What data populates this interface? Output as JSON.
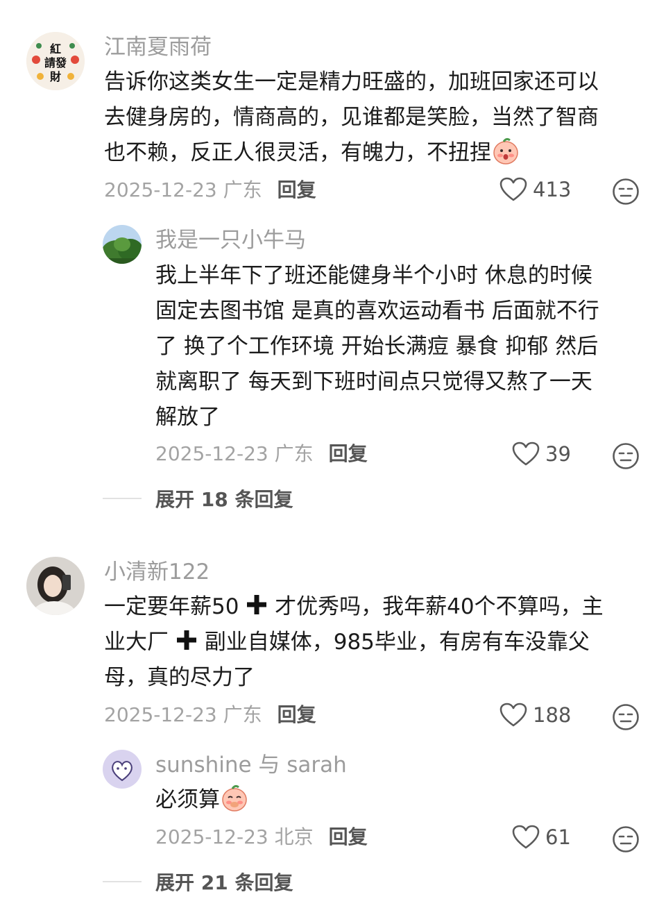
{
  "comments": [
    {
      "username": "江南夏雨荷",
      "avatar_text": "紅請發財",
      "lines": [
        "告诉你这类女生一定是精力旺盛的，加班回家还可以",
        "去健身房的，情商高的，见谁都是笑脸，当然了智商",
        "也不赖，反正人很灵活，有魄力，不扭捏"
      ],
      "emoji": "blushing-peach-emoji",
      "meta": "2025-12-23 广东",
      "reply_label": "回复",
      "likes": "413",
      "reply": {
        "username": "我是一只小牛马",
        "lines": [
          "我上半年下了班还能健身半个小时  休息的时候",
          "固定去图书馆 是真的喜欢运动看书 后面就不行",
          "了  换了个工作环境 开始长满痘 暴食 抑郁 然后",
          "就离职了 每天到下班时间点只觉得又熬了一天",
          "解放了"
        ],
        "meta": "2025-12-23 广东",
        "reply_label": "回复",
        "likes": "39"
      },
      "expand_label": "展开 18 条回复"
    },
    {
      "username": "小清新122",
      "line1_a": "一定要年薪50",
      "line1_b": "才优秀吗，我年薪40个不算吗，主",
      "line2_a": "业大厂",
      "line2_b": "副业自媒体，985毕业，有房有车没靠父",
      "line3": "母，真的尽力了",
      "meta": "2025-12-23 广东",
      "reply_label": "回复",
      "likes": "188",
      "reply": {
        "username": "sunshine 与 sarah",
        "text": "必须算",
        "emoji": "shy-peach-emoji",
        "meta": "2025-12-23 北京",
        "reply_label": "回复",
        "likes": "61"
      },
      "expand_label": "展开 21 条回复"
    }
  ]
}
